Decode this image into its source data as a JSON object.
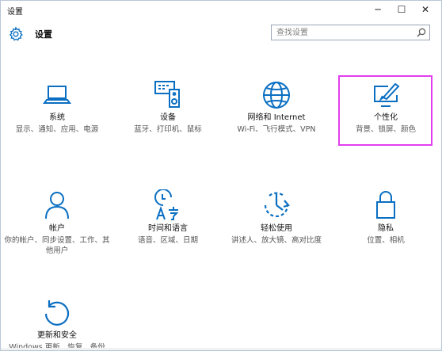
{
  "window": {
    "title": "设置",
    "minimize": "─",
    "maximize": "☐",
    "close": "✕"
  },
  "header": {
    "title": "设置",
    "search_placeholder": "查找设置"
  },
  "accent_color": "#0a6fc2",
  "highlight_color": "#e23ef0",
  "tiles": [
    {
      "icon": "laptop-icon",
      "title": "系统",
      "desc": "显示、通知、应用、电源"
    },
    {
      "icon": "devices-icon",
      "title": "设备",
      "desc": "蓝牙、打印机、鼠标"
    },
    {
      "icon": "globe-icon",
      "title": "网络和 Internet",
      "desc": "Wi-Fi、飞行模式、VPN"
    },
    {
      "icon": "personalization-icon",
      "title": "个性化",
      "desc": "背景、锁屏、颜色"
    },
    {
      "icon": "person-icon",
      "title": "帐户",
      "desc": "你的帐户、同步设置、工作、其他用户"
    },
    {
      "icon": "time-language-icon",
      "title": "时间和语言",
      "desc": "语音、区域、日期"
    },
    {
      "icon": "ease-of-access-icon",
      "title": "轻松使用",
      "desc": "讲述人、放大镜、高对比度"
    },
    {
      "icon": "lock-icon",
      "title": "隐私",
      "desc": "位置、相机"
    },
    {
      "icon": "update-icon",
      "title": "更新和安全",
      "desc": "Windows 更新、恢复、备份"
    }
  ]
}
